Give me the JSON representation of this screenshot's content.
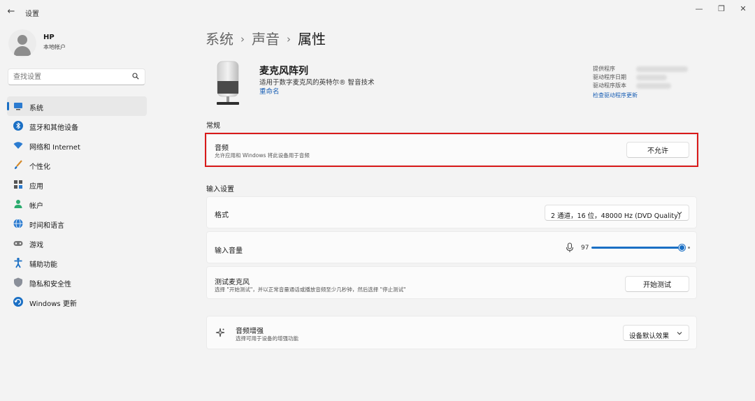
{
  "window": {
    "title": "设置",
    "back_glyph": "←",
    "minimize_glyph": "—",
    "restore_glyph": "❐",
    "close_glyph": "✕"
  },
  "user": {
    "name": "HP",
    "account_type": "本地帐户"
  },
  "search": {
    "placeholder": "查找设置"
  },
  "sidebar": {
    "items": [
      {
        "label": "系统",
        "icon": "system-icon",
        "active": true
      },
      {
        "label": "蓝牙和其他设备",
        "icon": "bluetooth-icon"
      },
      {
        "label": "网络和 Internet",
        "icon": "wifi-icon"
      },
      {
        "label": "个性化",
        "icon": "brush-icon"
      },
      {
        "label": "应用",
        "icon": "apps-icon"
      },
      {
        "label": "帐户",
        "icon": "account-icon"
      },
      {
        "label": "时间和语言",
        "icon": "globe-icon"
      },
      {
        "label": "游戏",
        "icon": "gamepad-icon"
      },
      {
        "label": "辅助功能",
        "icon": "accessibility-icon"
      },
      {
        "label": "隐私和安全性",
        "icon": "shield-icon"
      },
      {
        "label": "Windows 更新",
        "icon": "update-icon"
      }
    ]
  },
  "breadcrumb": {
    "items": [
      "系统",
      "声音",
      "属性"
    ],
    "separator": "›"
  },
  "device": {
    "name": "麦克风阵列",
    "description": "适用于数字麦克风的英特尔® 智音技术",
    "rename_link": "重命名"
  },
  "driver": {
    "provider_label": "提供程序",
    "date_label": "驱动程序日期",
    "version_label": "驱动程序版本",
    "check_link": "检查驱动程序更新"
  },
  "general": {
    "section_title": "常规",
    "audio_title": "音频",
    "audio_subtitle": "允许应用和 Windows 将此设备用于音频",
    "audio_button": "不允许"
  },
  "input": {
    "section_title": "输入设置",
    "format_label": "格式",
    "format_value": "2 通道，16 位，48000 Hz (DVD Quality)",
    "volume_label": "输入音量",
    "volume_value": "97",
    "test_title": "测试麦克风",
    "test_subtitle": "选择 \"开始测试\"，并以正常音量通话或播放音频至少几秒钟，然后选择 \"停止测试\"",
    "test_button": "开始测试"
  },
  "enhance": {
    "title": "音频增强",
    "subtitle": "选择可用于设备的增强功能",
    "value": "设备默认效果"
  },
  "colors": {
    "accent": "#1a6fc4",
    "highlight_outline": "#d91a1a",
    "link": "#1a5fb4"
  }
}
